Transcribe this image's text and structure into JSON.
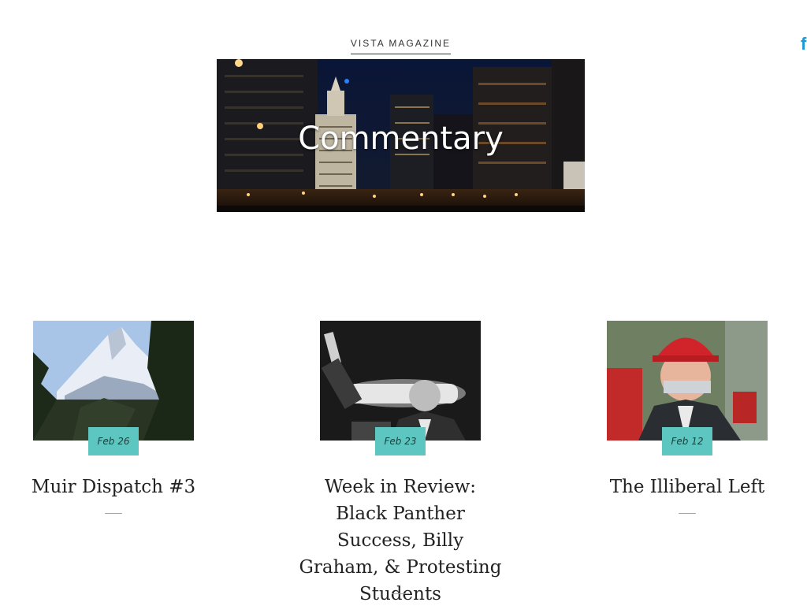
{
  "nav": {
    "site_name": "VISTA MAGAZINE"
  },
  "social": {
    "facebook_glyph": "f",
    "icon": "facebook-icon"
  },
  "hero": {
    "title": "Commentary"
  },
  "posts": [
    {
      "date": "Feb 26",
      "title": "Muir Dispatch #3"
    },
    {
      "date": "Feb 23",
      "title": "Week in Review: Black Panther Success, Billy Graham, & Protesting Students"
    },
    {
      "date": "Feb 12",
      "title": "The Illiberal Left"
    }
  ],
  "colors": {
    "accent": "#5ec6c0",
    "facebook": "#1f9ad6",
    "text": "#222222"
  }
}
